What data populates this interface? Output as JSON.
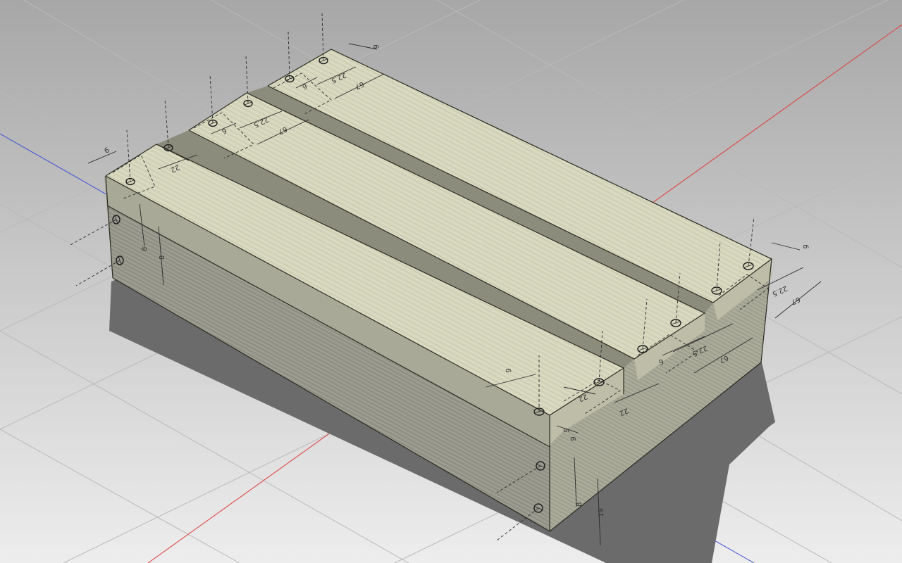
{
  "scene": {
    "background_top": "#a7a7a7",
    "background_bottom": "#ededed",
    "grid_color": "#b8b8b8",
    "axis_x_color": "#e03a3a",
    "axis_y_color": "#3a4fd8",
    "wood_top": "#d6d6bc",
    "wood_side": "#a9a997",
    "wood_front": "#96968a",
    "shadow": "#6b6b6b"
  },
  "dimensions": {
    "d6": "6",
    "d22": "22",
    "d225": "22.5",
    "d67": "67",
    "d8": "8",
    "d19": "19"
  },
  "icons": [
    "screw-hole-icon"
  ]
}
